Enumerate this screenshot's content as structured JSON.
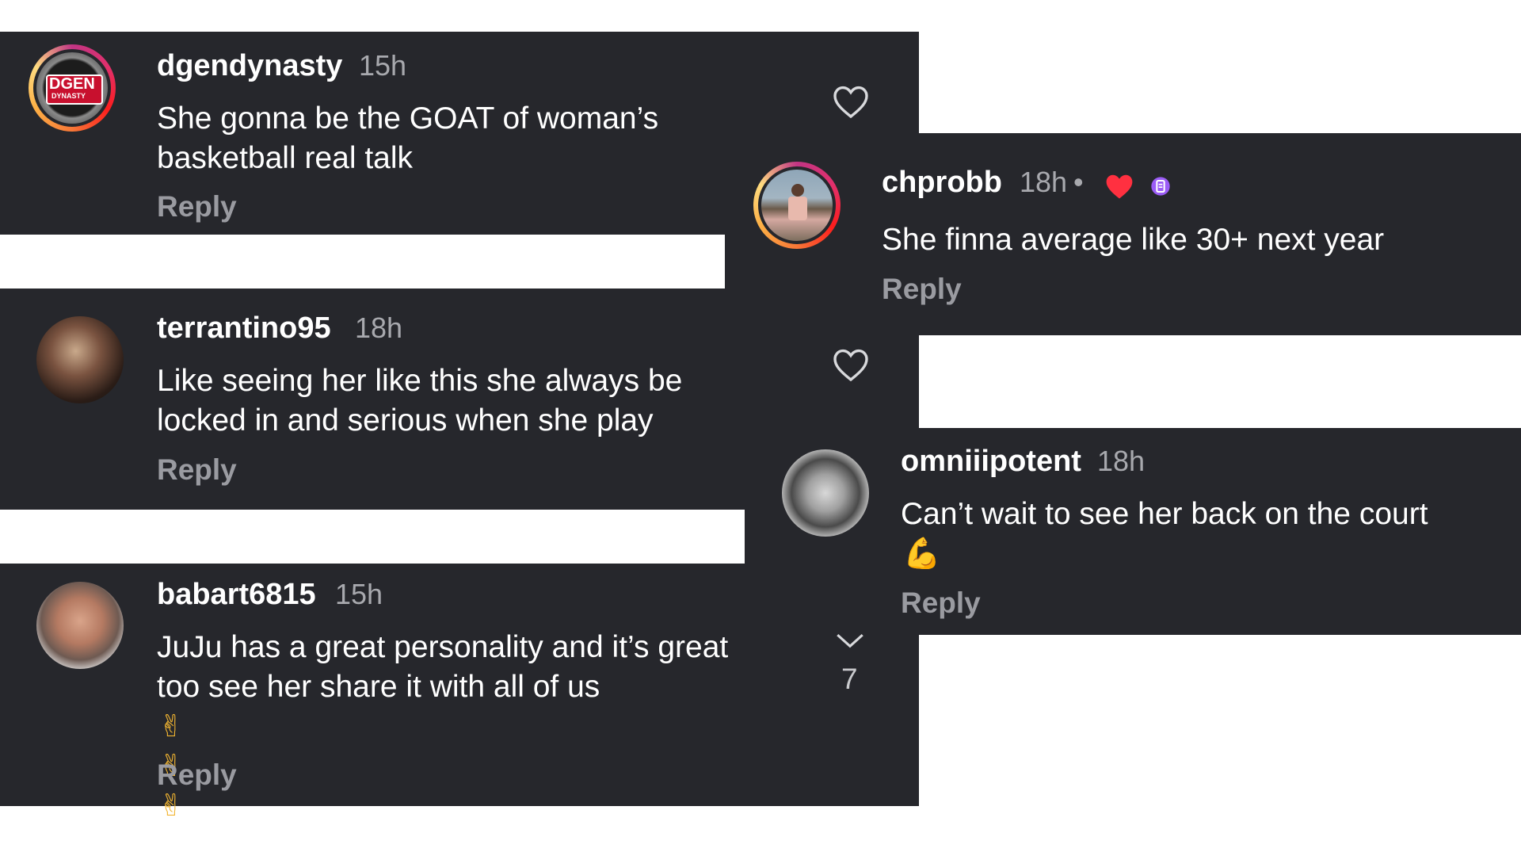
{
  "comments_left": [
    {
      "username": "dgendynasty",
      "time": "15h",
      "text": "She gonna be the GOAT of woman’s basketball real talk",
      "reply": "Reply",
      "avatar_text_1": "DGEN",
      "avatar_text_2": "DYNASTY"
    },
    {
      "username": "terrantino95",
      "time": "18h",
      "text": "Like seeing her like this she always be locked in and serious when she play",
      "reply": "Reply"
    },
    {
      "username": "babart6815",
      "time": "15h",
      "text": "JuJu has a great personality and it’s great too see her share it with all of us",
      "emojis": "✌✌✌",
      "reply": "Reply",
      "likes_count": "7"
    }
  ],
  "comments_right": [
    {
      "username": "chprobb",
      "time": "18h",
      "separator": "•",
      "reply": "Reply",
      "text": "She finna average like 30+ next year"
    },
    {
      "username": "omniiipotent",
      "time": "18h",
      "text": "Can’t wait to see her back on the court",
      "emoji": "💪",
      "reply": "Reply"
    }
  ],
  "colors": {
    "panel_bg": "#26272c",
    "username": "#ffffff",
    "meta": "#a8a9ae",
    "heart_liked": "#ff3040",
    "badge": "#9b5cf6"
  },
  "icons": [
    "heart-outline-icon",
    "heart-filled-icon",
    "chevron-down-icon",
    "verified-badge-icon"
  ]
}
